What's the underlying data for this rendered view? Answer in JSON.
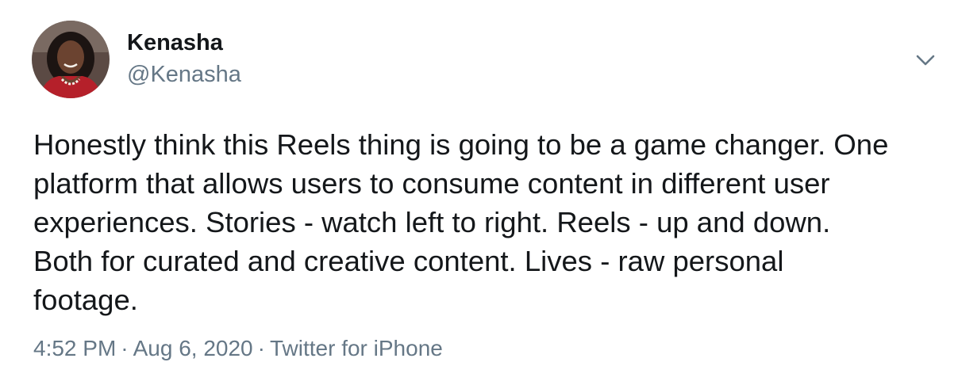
{
  "author": {
    "display_name": "Kenasha",
    "handle": "@Kenasha",
    "avatar_icon": "profile-photo"
  },
  "menu_icon": "chevron-down-icon",
  "tweet": {
    "text": "Honestly think this Reels thing is going to be a game changer. One\nplatform that allows users to consume content in different user\nexperiences. Stories - watch left to right. Reels - up and down.\nBoth for curated and creative content. Lives - raw personal\nfootage."
  },
  "meta": {
    "time": "4:52 PM",
    "separator": "·",
    "date": "Aug 6, 2020",
    "source": "Twitter for iPhone"
  },
  "colors": {
    "text": "#14171a",
    "secondary": "#657786",
    "background": "#ffffff"
  }
}
